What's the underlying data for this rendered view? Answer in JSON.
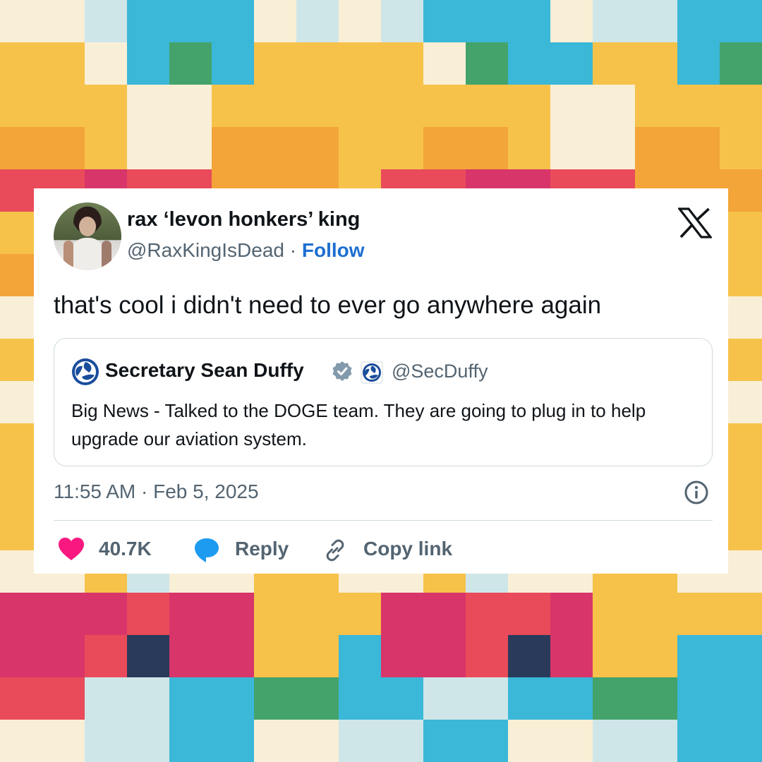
{
  "background": {
    "colors": [
      "#f6c24a",
      "#f3a53a",
      "#e94b5a",
      "#d8356a",
      "#3bb7d8",
      "#44a36b",
      "#f9efd7",
      "#cfe6e8",
      "#2a3a5a"
    ]
  },
  "tweet": {
    "author": {
      "display_name": "rax ‘levon honkers’ king",
      "handle": "@RaxKingIsDead",
      "separator": " · ",
      "follow_label": "Follow"
    },
    "text": "that's cool i didn't need to ever go anywhere again",
    "quoted": {
      "display_name": "Secretary Sean Duffy",
      "handle": "@SecDuffy",
      "text": "Big News - Talked to the DOGE team. They are going to plug in to help upgrade our aviation system."
    },
    "timestamp": "11:55 AM · Feb 5, 2025",
    "actions": {
      "like_count": "40.7K",
      "reply_label": "Reply",
      "copy_label": "Copy link"
    },
    "colors": {
      "like": "#f91880",
      "reply": "#1d9bf0",
      "follow": "#1d6fd1",
      "verified": "#829aab"
    }
  }
}
